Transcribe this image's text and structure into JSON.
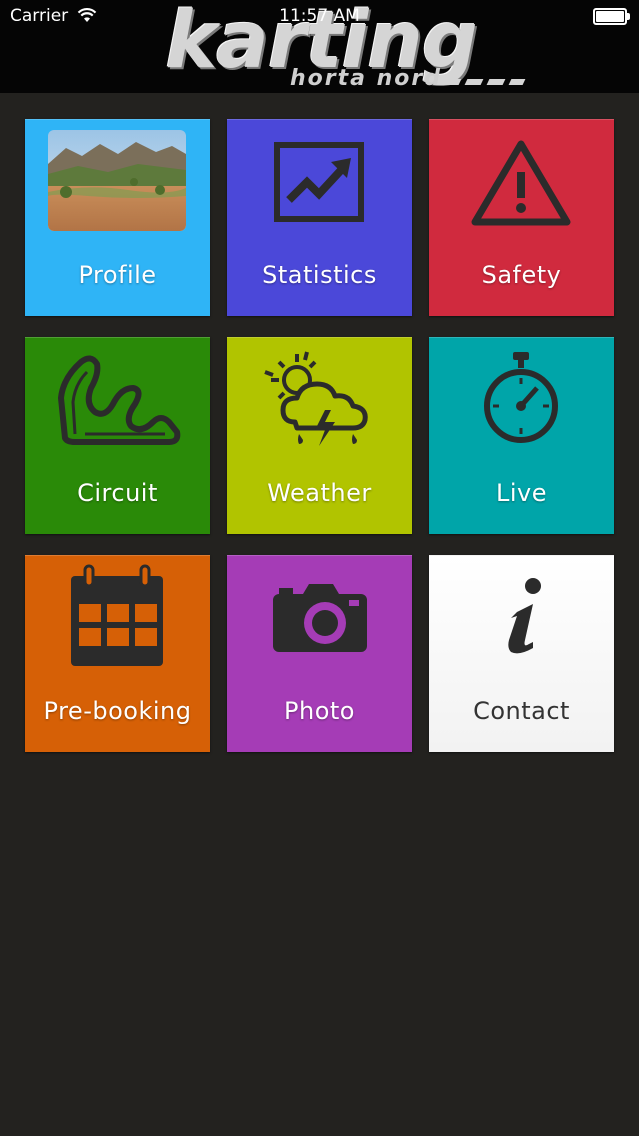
{
  "status_bar": {
    "carrier": "Carrier",
    "time": "11:57 AM"
  },
  "logo": {
    "main": "karting",
    "sub": "horta nord"
  },
  "tiles": [
    {
      "label": "Profile",
      "color": "#2fb4f6"
    },
    {
      "label": "Statistics",
      "color": "#4b48d9"
    },
    {
      "label": "Safety",
      "color": "#d02a3e"
    },
    {
      "label": "Circuit",
      "color": "#2a8a08"
    },
    {
      "label": "Weather",
      "color": "#b1c400"
    },
    {
      "label": "Live",
      "color": "#00a5a9"
    },
    {
      "label": "Pre-booking",
      "color": "#d66006"
    },
    {
      "label": "Photo",
      "color": "#a53cb6"
    },
    {
      "label": "Contact",
      "color": "#f2f2f2"
    }
  ]
}
